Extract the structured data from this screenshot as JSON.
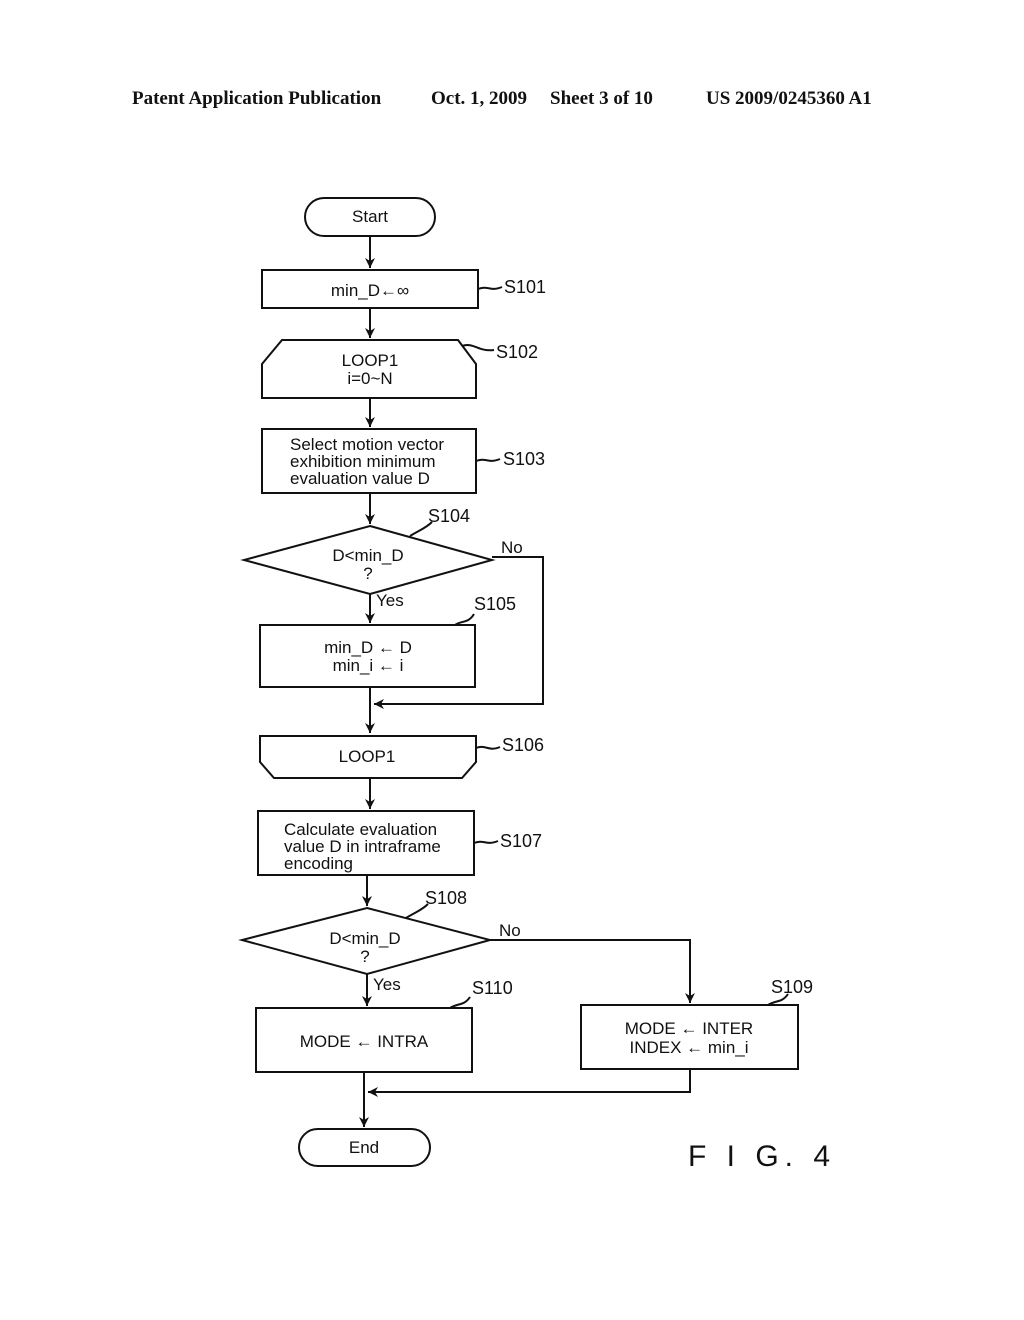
{
  "header": {
    "publication": "Patent Application Publication",
    "date": "Oct. 1, 2009",
    "sheet": "Sheet 3 of 10",
    "number": "US 2009/0245360 A1"
  },
  "flowchart": {
    "start": "Start",
    "end": "End",
    "s101": {
      "id": "S101",
      "lines": [
        "min_D←∞"
      ]
    },
    "s102": {
      "id": "S102",
      "lines": [
        "LOOP1",
        "i=0~N"
      ]
    },
    "s103": {
      "id": "S103",
      "lines": [
        "Select  motion  vector",
        "exhibition  minimum",
        "evaluation  value  D"
      ]
    },
    "s104": {
      "id": "S104",
      "lines": [
        "D<min_D",
        "?"
      ],
      "yes": "Yes",
      "no": "No"
    },
    "s105": {
      "id": "S105",
      "lines": [
        "min_D ← D",
        "min_i ← i"
      ]
    },
    "s106": {
      "id": "S106",
      "lines": [
        "LOOP1"
      ]
    },
    "s107": {
      "id": "S107",
      "lines": [
        "Calculate  evaluation",
        "value  D  in  intraframe",
        "encoding"
      ]
    },
    "s108": {
      "id": "S108",
      "lines": [
        "D<min_D",
        "?"
      ],
      "yes": "Yes",
      "no": "No"
    },
    "s109": {
      "id": "S109",
      "lines": [
        "MODE ← INTER",
        "INDEX ← min_i"
      ]
    },
    "s110": {
      "id": "S110",
      "lines": [
        "MODE ← INTRA"
      ]
    }
  },
  "figure_label": "F I G. 4"
}
